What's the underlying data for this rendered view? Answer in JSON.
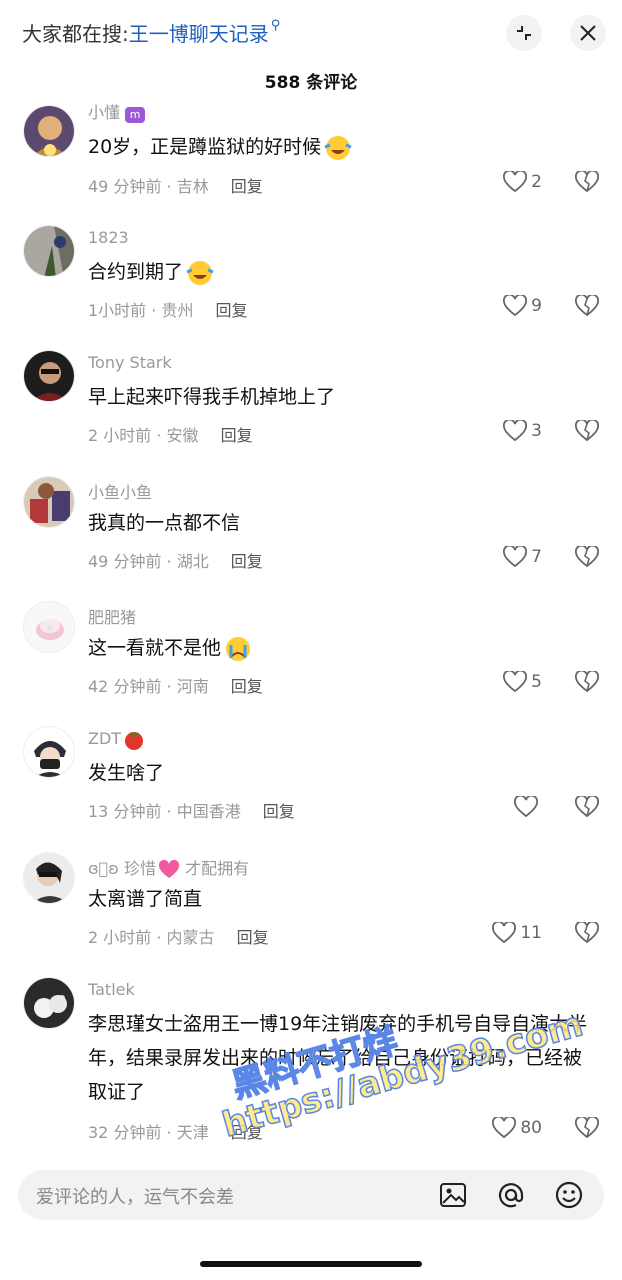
{
  "header": {
    "search_prefix": "大家都在搜:",
    "search_keyword": "王一博聊天记录",
    "comment_count": "588 条评论"
  },
  "comments": [
    {
      "user": "小懂",
      "text": "20岁，正是蹲监狱的好时候",
      "time": "49 分钟前",
      "location": "吉林",
      "likes": "2"
    },
    {
      "user": "1823",
      "text": "合约到期了",
      "time": "1小时前",
      "location": "贵州",
      "likes": "9"
    },
    {
      "user": "Tony Stark",
      "text": "早上起来吓得我手机掉地上了",
      "time": "2 小时前",
      "location": "安徽",
      "likes": "3"
    },
    {
      "user": "小鱼小鱼",
      "text": "我真的一点都不信",
      "time": "49 分钟前",
      "location": "湖北",
      "likes": "7"
    },
    {
      "user": "肥肥猪",
      "text": "这一看就不是他",
      "time": "42 分钟前",
      "location": "河南",
      "likes": "5"
    },
    {
      "user": "ZDT",
      "text": "发生啥了",
      "time": "13 分钟前",
      "location": "中国香港",
      "likes": ""
    },
    {
      "user": "珍惜",
      "user_suffix": "才配拥有",
      "text": "太离谱了简直",
      "time": "2 小时前",
      "location": "内蒙古",
      "likes": "11"
    },
    {
      "user": "Tatlek",
      "text": "李思瑾女士盗用王一博19年注销废弃的手机号自导自演大半年，结果录屏发出来的时候忘了给自己身份证打码，已经被取证了",
      "time": "32 分钟前",
      "location": "天津",
      "likes": "80"
    }
  ],
  "reply_label": "回复",
  "location_sep": " · ",
  "input_placeholder": "爱评论的人，运气不会差",
  "watermark": {
    "line1": "黑料不打烊",
    "line2": "https://abdy39.com"
  },
  "icons": {
    "collapse": "collapse-icon",
    "close": "close-icon",
    "like": "heart-icon",
    "dislike": "broken-heart-icon",
    "image": "image-icon",
    "mention": "at-icon",
    "emoji": "smile-icon"
  }
}
